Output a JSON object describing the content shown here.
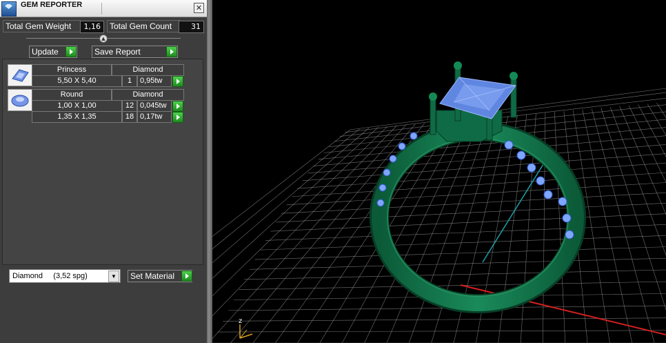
{
  "window": {
    "title": "GEM REPORTER",
    "close_glyph": "✕"
  },
  "stats": {
    "total_gem_weight_label": "Total Gem Weight",
    "total_gem_weight_value": "1,16",
    "total_gem_count_label": "Total Gem Count",
    "total_gem_count_value": "31"
  },
  "actions": {
    "update_label": "Update",
    "save_report_label": "Save Report"
  },
  "gem_groups": [
    {
      "cut": "Princess",
      "material": "Diamond",
      "rows": [
        {
          "size": "5,50 X 5,40",
          "count": "1",
          "weight": "0,95tw"
        }
      ]
    },
    {
      "cut": "Round",
      "material": "Diamond",
      "rows": [
        {
          "size": "1,00 X 1,00",
          "count": "12",
          "weight": "0,045tw"
        },
        {
          "size": "1,35 X 1,35",
          "count": "18",
          "weight": "0,17tw"
        }
      ]
    }
  ],
  "material_select": {
    "value": "Diamond     (3,52 spg)",
    "set_label": "Set Material"
  },
  "viewport": {
    "axis_label": "z"
  },
  "colors": {
    "ring": "#0f6b45",
    "gem": "#5f86e0",
    "grid": "#9a9a9a",
    "axis_x": "#d42020",
    "axis_y": "#1fa0a8"
  },
  "icons": [
    "app-gem-icon",
    "close-icon",
    "play-arrow-icon",
    "princess-gem-icon",
    "round-gem-icon",
    "chevron-down-icon"
  ]
}
